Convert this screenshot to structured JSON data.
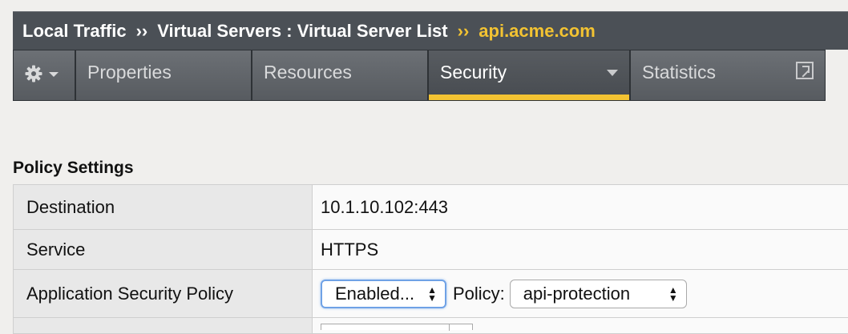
{
  "breadcrumb": {
    "items": [
      "Local Traffic",
      "Virtual Servers : Virtual Server List"
    ],
    "separator": "››",
    "current": "api.acme.com"
  },
  "tabs": {
    "gear_icon": "gear-icon",
    "items": [
      {
        "label": "Properties"
      },
      {
        "label": "Resources"
      },
      {
        "label": "Security",
        "active": true
      },
      {
        "label": "Statistics"
      }
    ]
  },
  "section": {
    "title": "Policy Settings",
    "rows": [
      {
        "label": "Destination",
        "value": "10.1.10.102:443"
      },
      {
        "label": "Service",
        "value": "HTTPS"
      },
      {
        "label": "Application Security Policy",
        "select_value": "Enabled...",
        "policy_label": "Policy:",
        "policy_value": "api-protection"
      }
    ]
  },
  "colors": {
    "header_bg": "#4b5056",
    "accent": "#f3c332",
    "tab_bg": "#575b60"
  }
}
